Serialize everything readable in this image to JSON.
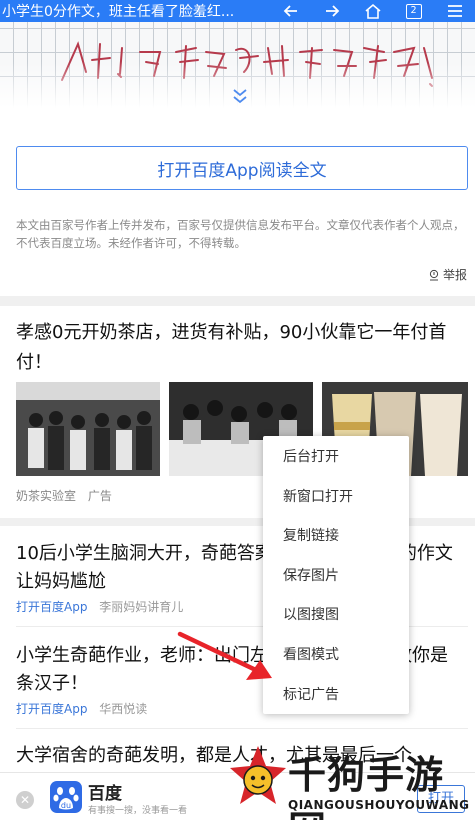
{
  "topbar": {
    "title": "小学生0分作文，班主任看了脸羞红...",
    "tab_count": "2",
    "icons": [
      "back-icon",
      "forward-icon",
      "home-icon",
      "tabs-icon",
      "menu-icon"
    ]
  },
  "article": {
    "handwriting_text": "人才！吃货的世界真不懂！",
    "open_app_label": "打开百度App阅读全文",
    "disclaimer": "本文由百家号作者上传并发布，百家号仅提供信息发布平台。文章仅代表作者个人观点，不代表百度立场。未经作者许可，不得转载。",
    "report_label": "举报"
  },
  "ad": {
    "title": "孝感0元开奶茶店，进货有补贴，90小伙靠它一年付首付！",
    "source": "奶茶实验室",
    "tag": "广告"
  },
  "feed": [
    {
      "title": "10后小学生脑洞大开，奇葩答案，一年级小学生的作文让妈妈尴尬",
      "app_link": "打开百度App",
      "source": "李丽妈妈讲育儿"
    },
    {
      "title": "小学生奇葩作业，老师：出门左转不送！网友：敬你是条汉子！",
      "app_link": "打开百度App",
      "source": "华西悦读"
    },
    {
      "title": "大学宿舍的奇葩发明，都是人才，尤其是最后一个"
    }
  ],
  "context_menu": {
    "items": [
      "后台打开",
      "新窗口打开",
      "复制链接",
      "保存图片",
      "以图搜图",
      "看图模式",
      "标记广告"
    ]
  },
  "bottom_bar": {
    "close_glyph": "✕",
    "app_name": "百度",
    "slogan": "有事搜一搜，没事看一看",
    "open_label": "打开"
  },
  "watermark": {
    "text": "千狗手游网",
    "sub": "QIANGOUSHOUYOUWANG"
  },
  "colors": {
    "accent": "#2a7cf6",
    "link": "#3a76d8",
    "arrow": "#e8242a"
  }
}
